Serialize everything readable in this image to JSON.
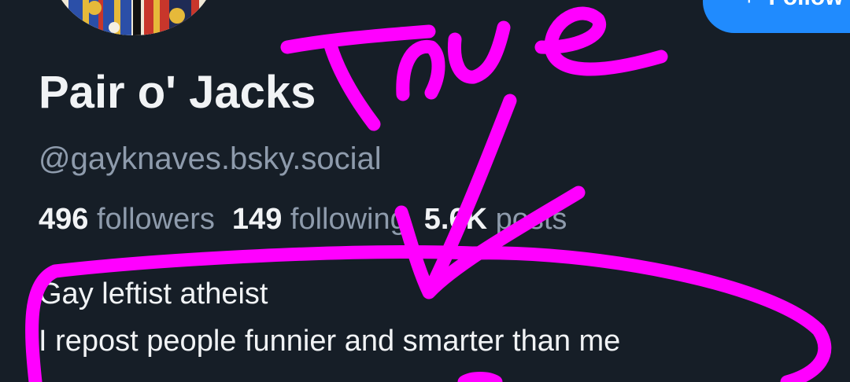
{
  "profile": {
    "display_name": "Pair o' Jacks",
    "handle": "@gayknaves.bsky.social",
    "follow_label": "Follow",
    "avatar_icon": "jack-playing-card-avatar",
    "stats": {
      "followers_count": "496",
      "followers_label": "followers",
      "following_count": "149",
      "following_label": "following",
      "posts_count": "5.6K",
      "posts_label": "posts"
    },
    "bio": {
      "line1": "Gay leftist atheist",
      "line2": "I repost people funnier and smarter than me"
    }
  },
  "annotation": {
    "handwritten_text": "True",
    "color": "#ff00ff",
    "marks": [
      "checkmark",
      "circle-around-bio"
    ]
  },
  "colors": {
    "background": "#161e27",
    "text_primary": "#f1f3f5",
    "text_secondary": "#8e9bac",
    "follow_button": "#208bfe"
  }
}
